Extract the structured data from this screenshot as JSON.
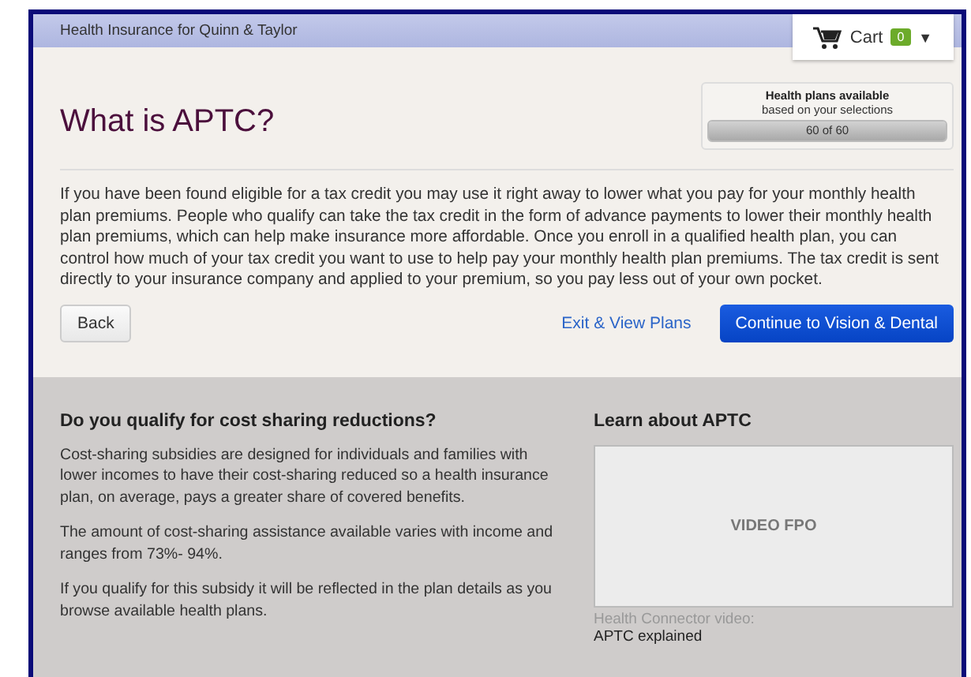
{
  "header": {
    "title": "Health Insurance for Quinn & Taylor",
    "cart": {
      "label": "Cart",
      "count": "0",
      "caret": "▼"
    }
  },
  "page": {
    "title": "What is APTC?"
  },
  "plans_available": {
    "title": "Health plans available",
    "subtitle": "based on your selections",
    "reading": "60 of 60",
    "level": 1
  },
  "intro": "If you have been found eligible for a tax credit you may use it right away to lower what you pay for your monthly health plan premiums. People who qualify can take the tax credit in the form of advance payments to lower their monthly health plan premiums, which can help make insurance more affordable. Once you enroll in a qualified health plan, you can control how much of your tax credit you want to use to help pay your monthly health plan premiums. The tax credit is sent directly to your insurance company and applied to your premium, so you pay less out of your own pocket.",
  "buttons": {
    "back": "Back",
    "exit": "Exit & View Plans",
    "continue": "Continue to Vision & Dental"
  },
  "cost_sharing": {
    "heading": "Do you qualify for cost sharing reductions?",
    "paragraphs": [
      "Cost-sharing subsidies are designed for individuals and families with lower incomes to have their cost-sharing reduced so a health insurance plan, on average, pays a greater share of covered benefits.",
      "The amount of cost-sharing assistance available varies with income and ranges from 73%- 94%.",
      "If you qualify for this subsidy it will be reflected in the plan details as you browse available health plans."
    ]
  },
  "learn": {
    "heading": "Learn about APTC",
    "video_label": "VIDEO FPO",
    "caption": "Health Connector video:",
    "caption_2": "APTC explained"
  }
}
